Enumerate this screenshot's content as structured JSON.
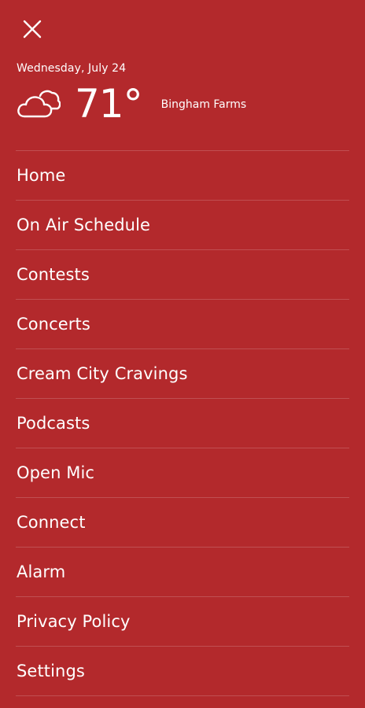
{
  "header": {
    "close_icon": "close-icon"
  },
  "weather": {
    "date": "Wednesday, July 24",
    "temperature": "71°",
    "location": "Bingham Farms",
    "icon": "partly-cloudy-icon"
  },
  "menu": {
    "items": [
      {
        "label": "Home"
      },
      {
        "label": "On Air Schedule"
      },
      {
        "label": "Contests"
      },
      {
        "label": "Concerts"
      },
      {
        "label": "Cream City Cravings"
      },
      {
        "label": "Podcasts"
      },
      {
        "label": "Open Mic"
      },
      {
        "label": "Connect"
      },
      {
        "label": "Alarm"
      },
      {
        "label": "Privacy Policy"
      },
      {
        "label": "Settings"
      }
    ]
  },
  "colors": {
    "background": "#b3292c",
    "text": "#ffffff"
  }
}
